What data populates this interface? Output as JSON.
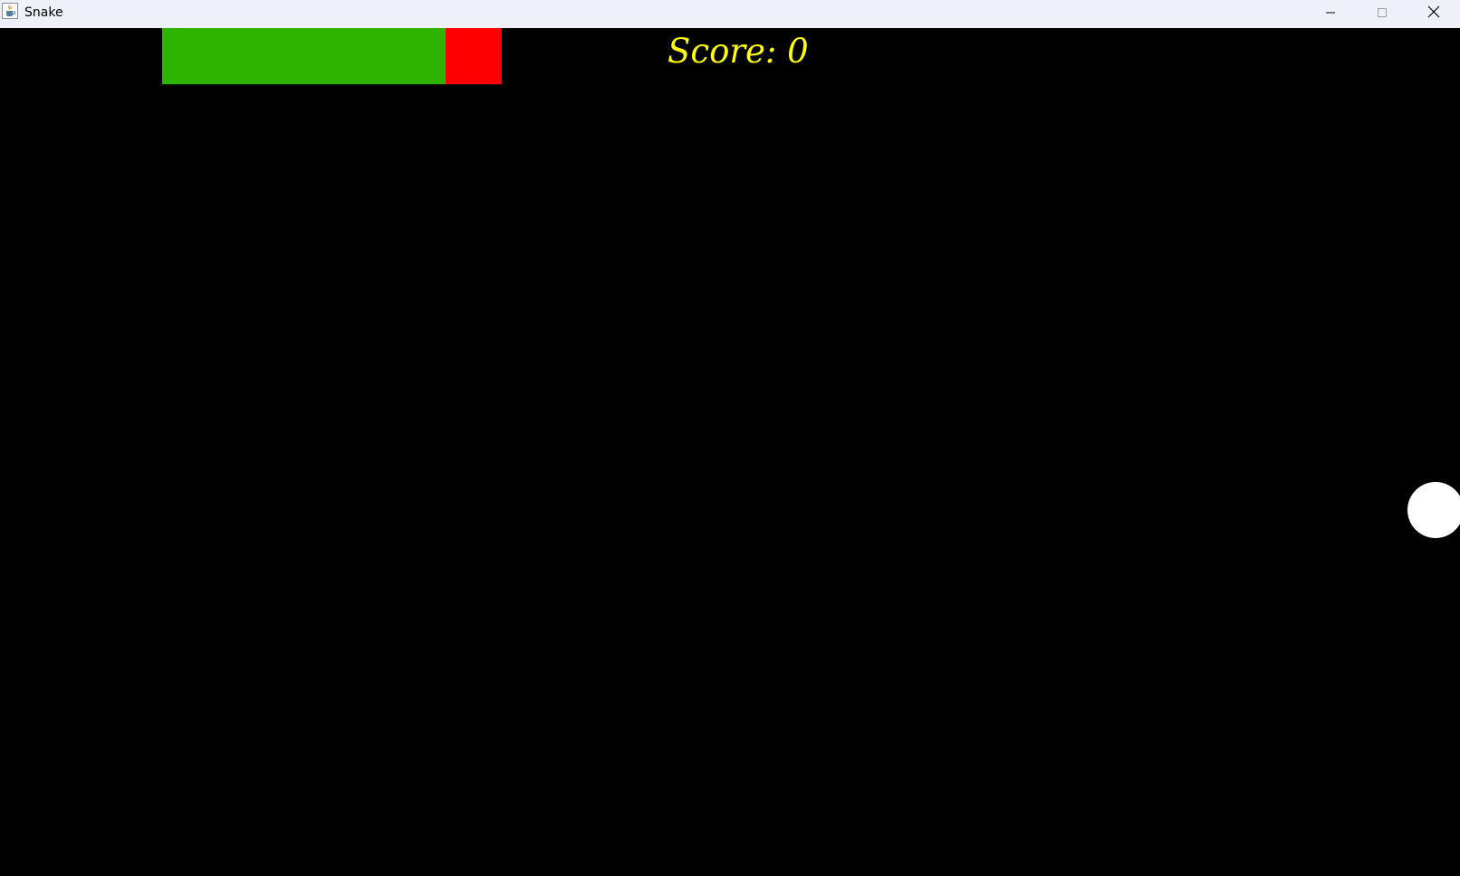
{
  "window": {
    "title": "Snake",
    "app_icon": "java-cup-icon",
    "controls": {
      "minimize_icon": "minimize-icon",
      "maximize_icon": "maximize-icon",
      "close_icon": "close-icon"
    }
  },
  "game": {
    "score_label": "Score: 0",
    "score": 0,
    "colors": {
      "background": "#000000",
      "snake_body": "#2db300",
      "snake_head": "#ff0000",
      "food": "#ffffff",
      "score_text": "#ffff00"
    }
  }
}
